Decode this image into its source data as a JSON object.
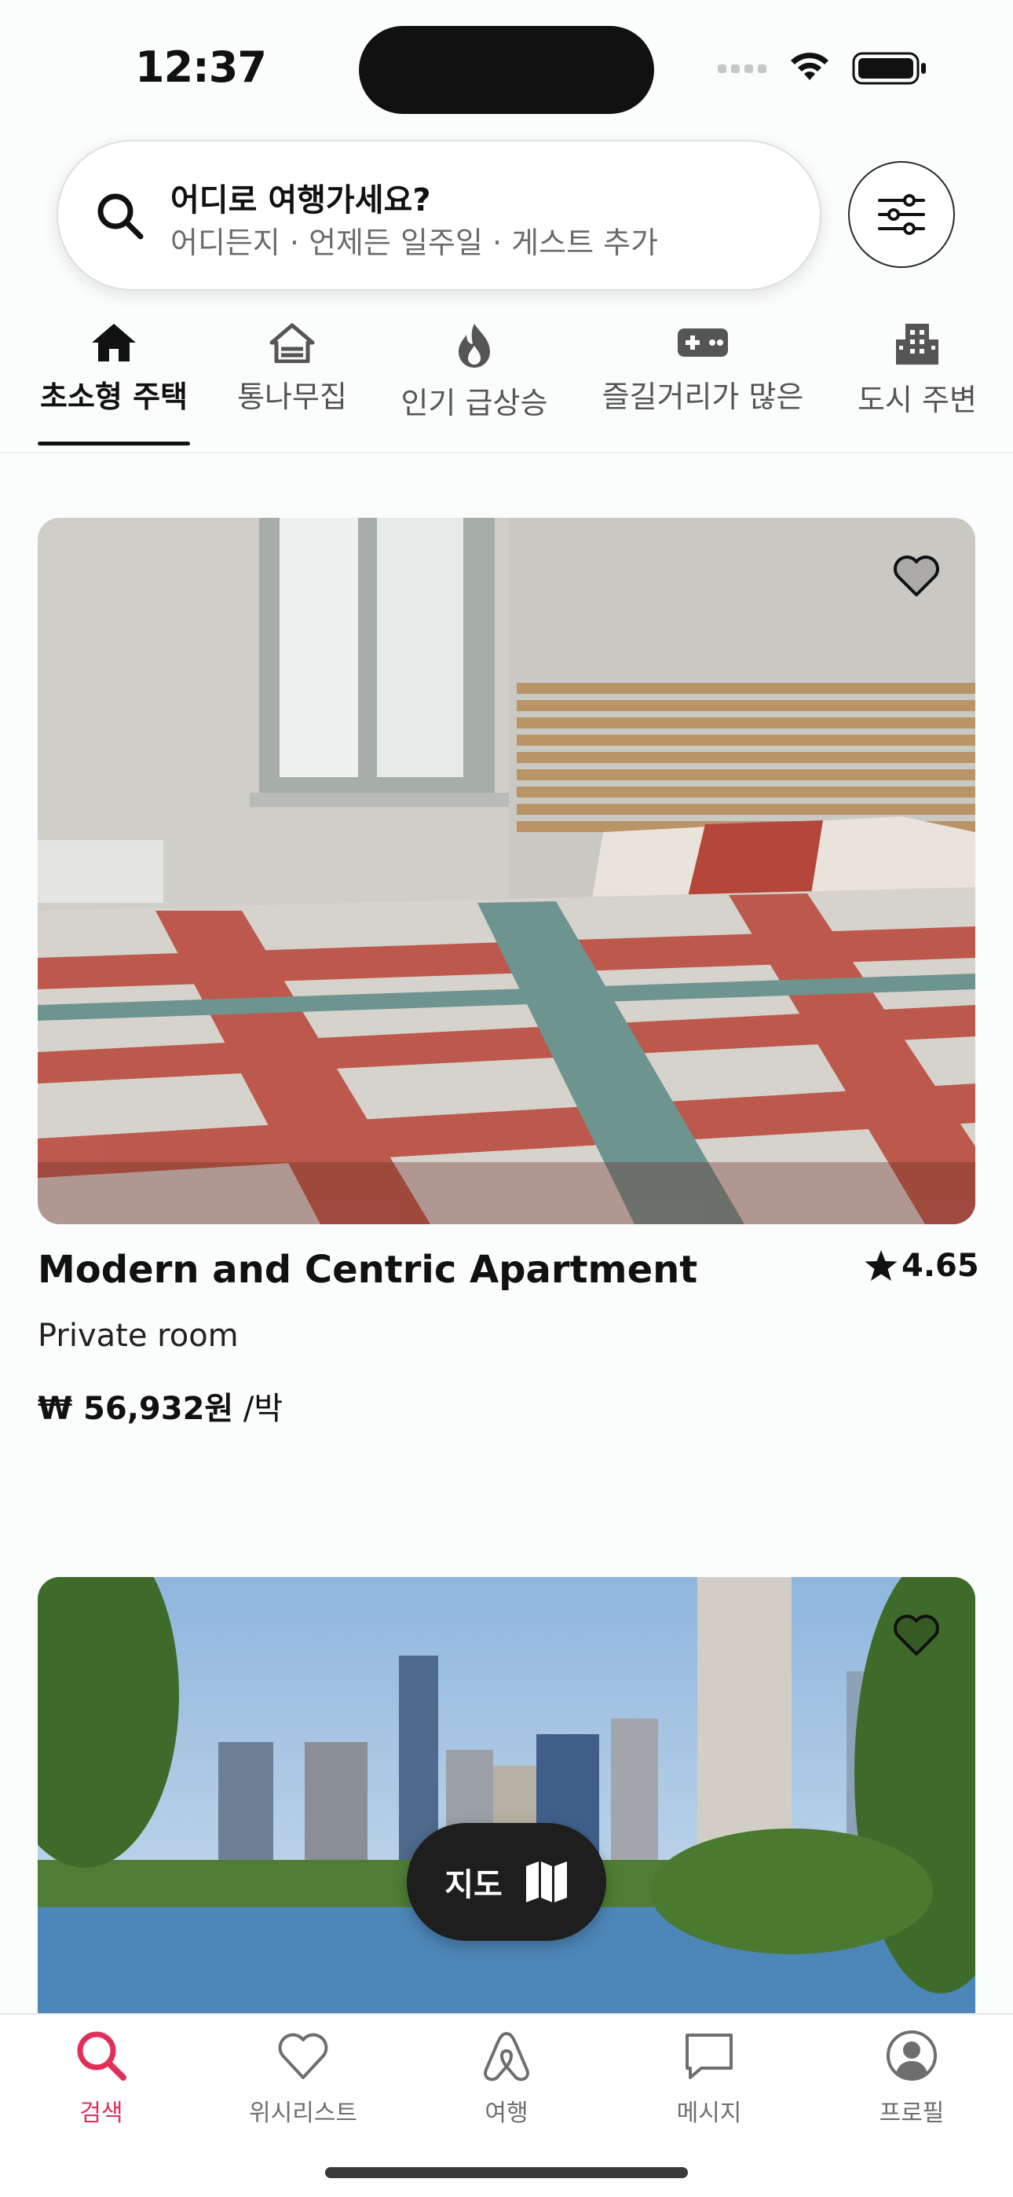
{
  "status_bar": {
    "time": "12:37"
  },
  "search": {
    "title": "어디로 여행가세요?",
    "subtitle": "어디든지 · 언제든 일주일 · 게스트 추가"
  },
  "categories": [
    {
      "label": "초소형 주택",
      "icon": "house-icon",
      "active": true
    },
    {
      "label": "통나무집",
      "icon": "cabin-icon",
      "active": false
    },
    {
      "label": "인기 급상승",
      "icon": "fire-icon",
      "active": false
    },
    {
      "label": "즐길거리가 많은",
      "icon": "gamepad-icon",
      "active": false
    },
    {
      "label": "도시 주변",
      "icon": "building-icon",
      "active": false
    }
  ],
  "listings": [
    {
      "title": "Modern and Centric Apartment",
      "rating": "4.65",
      "room_type": "Private room",
      "price": "₩ 56,932원",
      "price_unit": " /박"
    }
  ],
  "map_button": {
    "label": "지도"
  },
  "tab_bar": [
    {
      "label": "검색",
      "icon": "search-icon",
      "active": true
    },
    {
      "label": "위시리스트",
      "icon": "heart-icon",
      "active": false
    },
    {
      "label": "여행",
      "icon": "airbnb-logo-icon",
      "active": false
    },
    {
      "label": "메시지",
      "icon": "message-icon",
      "active": false
    },
    {
      "label": "프로필",
      "icon": "profile-icon",
      "active": false
    }
  ],
  "colors": {
    "accent": "#e0305a",
    "text": "#222222",
    "muted": "#6e6e6e"
  }
}
